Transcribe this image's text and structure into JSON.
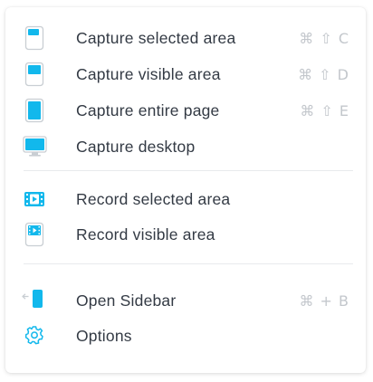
{
  "menu": {
    "items": [
      {
        "label": "Capture selected area",
        "shortcut": "⌘ ⇧ C",
        "icon": "capture-selected-icon"
      },
      {
        "label": "Capture visible area",
        "shortcut": "⌘ ⇧ D",
        "icon": "capture-visible-icon"
      },
      {
        "label": "Capture entire page",
        "shortcut": "⌘ ⇧ E",
        "icon": "capture-entire-page-icon"
      },
      {
        "label": "Capture desktop",
        "shortcut": "",
        "icon": "desktop-icon"
      },
      {
        "label": "Record selected area",
        "shortcut": "",
        "icon": "record-selected-icon"
      },
      {
        "label": "Record visible area",
        "shortcut": "",
        "icon": "record-visible-icon"
      },
      {
        "label": "Open Sidebar",
        "shortcut": "⌘ + B",
        "icon": "open-sidebar-icon"
      },
      {
        "label": "Options",
        "shortcut": "",
        "icon": "gear-icon"
      }
    ]
  },
  "colors": {
    "accent": "#12b8ec",
    "icon_outline": "#c9ced3",
    "text": "#333a44",
    "shortcut": "#c3c7cc",
    "divider": "#e8eaed"
  }
}
